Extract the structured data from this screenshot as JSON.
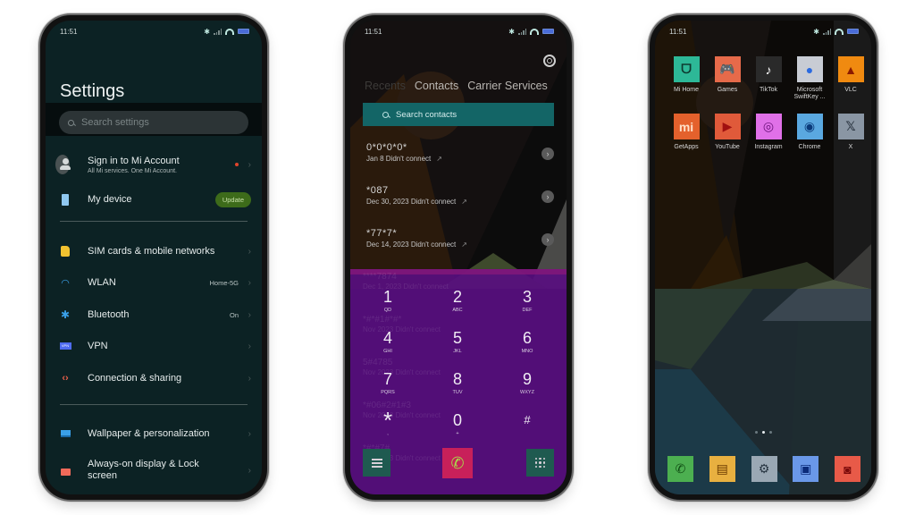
{
  "settings": {
    "status_time": "11:51",
    "title": "Settings",
    "search_placeholder": "Search settings",
    "account": {
      "title": "Sign in to Mi Account",
      "subtitle": "All Mi services. One Mi Account."
    },
    "my_device": {
      "label": "My device",
      "badge": "Update"
    },
    "items": [
      {
        "label": "SIM cards & mobile networks",
        "value": "",
        "icon": "sim-card-icon",
        "color": "#f2c230"
      },
      {
        "label": "WLAN",
        "value": "Home-5G",
        "icon": "wifi-icon",
        "color": "#3aa0e8"
      },
      {
        "label": "Bluetooth",
        "value": "On",
        "icon": "bluetooth-icon",
        "color": "#3aa0e8"
      },
      {
        "label": "VPN",
        "value": "",
        "icon": "vpn-icon",
        "color": "#4f6cf0"
      },
      {
        "label": "Connection & sharing",
        "value": "",
        "icon": "connection-sharing-icon",
        "color": "#e8604a"
      }
    ],
    "items2": [
      {
        "label": "Wallpaper & personalization",
        "icon": "wallpaper-icon",
        "color": "#3aa0e8"
      },
      {
        "label": "Always-on display & Lock screen",
        "icon": "lock-icon",
        "color": "#f06a5a"
      }
    ],
    "chevron": "›"
  },
  "dialer": {
    "status_time": "11:51",
    "tabs": [
      "Recents",
      "Contacts",
      "Carrier Services"
    ],
    "search_placeholder": "Search contacts",
    "calls": [
      {
        "number": "0*0*0*0*",
        "meta": "Jan 8 Didn't connect"
      },
      {
        "number": "*087",
        "meta": "Dec 30, 2023 Didn't connect"
      },
      {
        "number": "*77*7*",
        "meta": "Dec 14, 2023 Didn't connect"
      }
    ],
    "ghost_calls": [
      {
        "number": "****7874",
        "meta": "Dec 1, 2023 Didn't connect"
      },
      {
        "number": "*#*#1#*#*",
        "meta": "Nov 2023 Didn't connect"
      },
      {
        "number": "5#4785",
        "meta": "Nov 2023 Didn't connect"
      },
      {
        "number": "*#06#2#1#3",
        "meta": "Nov 2023 Didn't connect"
      },
      {
        "number": "*#*#7#",
        "meta": "Nov 2023 Didn't connect"
      }
    ],
    "outgoing_arrow": "↗",
    "detail_arrow": "›",
    "keys": [
      {
        "digit": "1",
        "letters": "QD"
      },
      {
        "digit": "2",
        "letters": "ABC"
      },
      {
        "digit": "3",
        "letters": "DEF"
      },
      {
        "digit": "4",
        "letters": "GHI"
      },
      {
        "digit": "5",
        "letters": "JKL"
      },
      {
        "digit": "6",
        "letters": "MNO"
      },
      {
        "digit": "7",
        "letters": "PQRS"
      },
      {
        "digit": "8",
        "letters": "TUV"
      },
      {
        "digit": "9",
        "letters": "WXYZ"
      },
      {
        "digit": "*",
        "letters": ","
      },
      {
        "digit": "0",
        "letters": "+"
      },
      {
        "digit": "#",
        "letters": ""
      }
    ],
    "colors": {
      "dialpad": "#580e80",
      "call_button": "#c8205a",
      "side_buttons": "#1f5a50",
      "search": "#136566"
    }
  },
  "home": {
    "status_time": "11:51",
    "apps": [
      {
        "label": "Mi Home",
        "icon": "mi-home-icon",
        "bg": "#2db897",
        "glyph": "ᗜ",
        "fg": "#0e3a30"
      },
      {
        "label": "Games",
        "icon": "games-icon",
        "bg": "#e66a4a",
        "glyph": "🎮",
        "fg": "#ffffff"
      },
      {
        "label": "TikTok",
        "icon": "tiktok-icon",
        "bg": "#2a2a2a",
        "glyph": "♪",
        "fg": "#ffffff"
      },
      {
        "label": "Microsoft SwiftKey ...",
        "icon": "swiftkey-icon",
        "bg": "#c8ccd4",
        "glyph": "●",
        "fg": "#2a6ae0"
      },
      {
        "label": "VLC",
        "icon": "vlc-icon",
        "bg": "#f08a10",
        "glyph": "▲",
        "fg": "#8a1a00"
      },
      {
        "label": "GetApps",
        "icon": "getapps-icon",
        "bg": "#e4612c",
        "glyph": "mi",
        "fg": "#ffe0c8"
      },
      {
        "label": "YouTube",
        "icon": "youtube-icon",
        "bg": "#e05a3a",
        "glyph": "▶",
        "fg": "#a01010"
      },
      {
        "label": "Instagram",
        "icon": "instagram-icon",
        "bg": "#e070e8",
        "glyph": "◎",
        "fg": "#6a107a"
      },
      {
        "label": "Chrome",
        "icon": "chrome-icon",
        "bg": "#5aa8e0",
        "glyph": "◉",
        "fg": "#0a3a7a"
      },
      {
        "label": "X",
        "icon": "x-icon",
        "bg": "#8a96a4",
        "glyph": "𝕏",
        "fg": "#2a3440"
      }
    ],
    "dock": [
      {
        "name": "phone-icon",
        "bg": "#4caf50",
        "glyph": "✆",
        "fg": "#0e4a12"
      },
      {
        "name": "messages-icon",
        "bg": "#e8b040",
        "glyph": "▤",
        "fg": "#6a3a00"
      },
      {
        "name": "settings-icon",
        "bg": "#9aa8b4",
        "glyph": "⚙",
        "fg": "#263440"
      },
      {
        "name": "gallery-icon",
        "bg": "#6a98e8",
        "glyph": "▣",
        "fg": "#0a2a7a"
      },
      {
        "name": "camera-icon",
        "bg": "#e85a48",
        "glyph": "◙",
        "fg": "#7a0a0a"
      }
    ],
    "page_count": 3,
    "active_page": 2
  }
}
